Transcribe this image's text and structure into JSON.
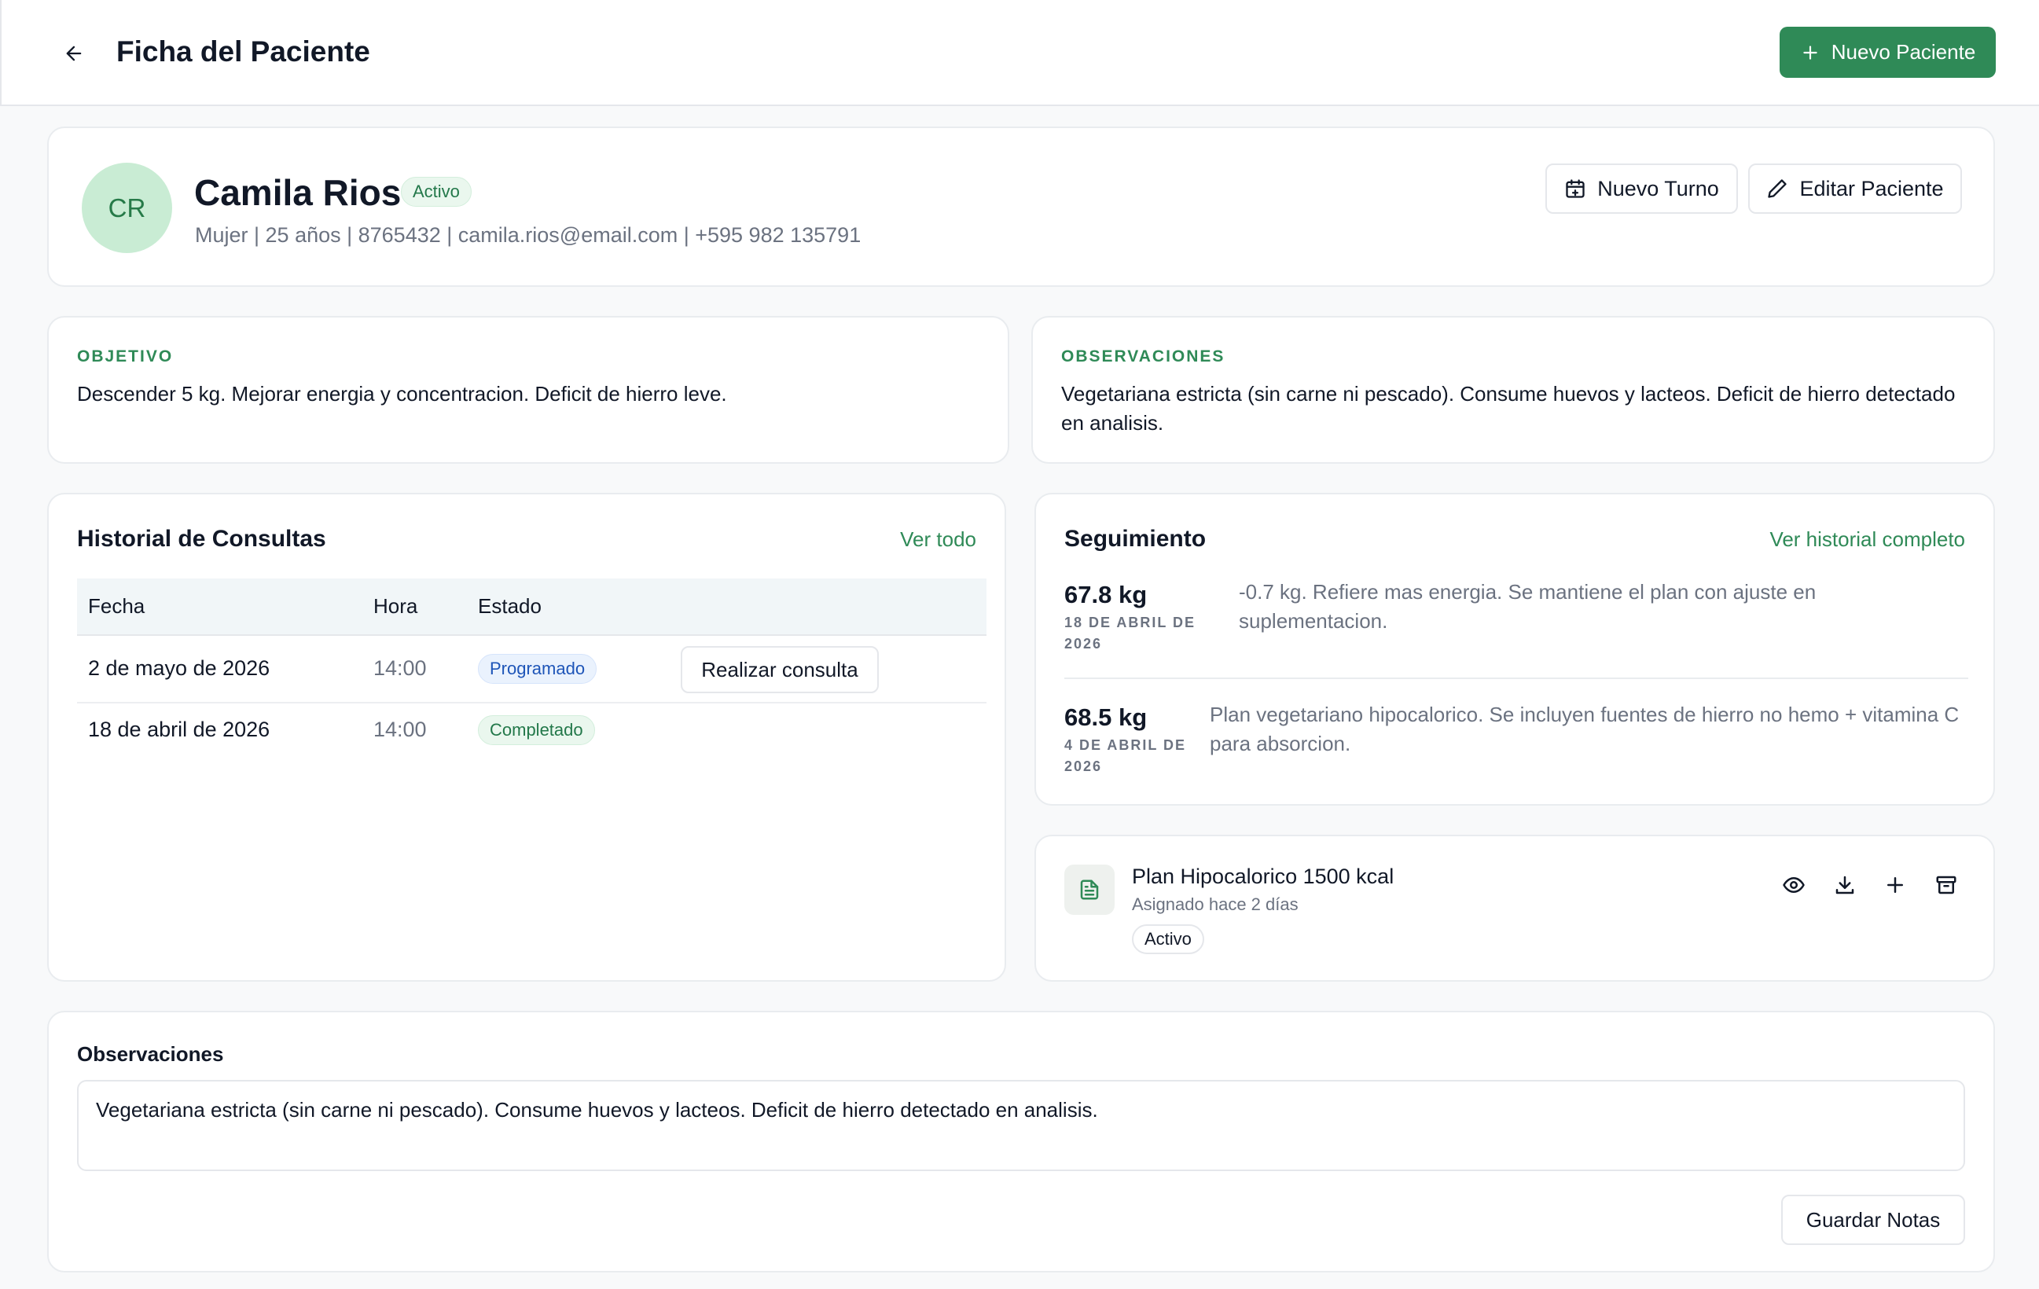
{
  "header": {
    "title": "Ficha del Paciente",
    "new_patient_label": "Nuevo Paciente"
  },
  "patient": {
    "initials": "CR",
    "name": "Camila Rios",
    "status": "Activo",
    "meta": "Mujer | 25 años | 8765432 | camila.rios@email.com | +595 982 135791",
    "new_appointment_label": "Nuevo Turno",
    "edit_label": "Editar Paciente"
  },
  "objective": {
    "label": "OBJETIVO",
    "text": "Descender 5 kg. Mejorar energia y concentracion. Deficit de hierro leve."
  },
  "observations_card": {
    "label": "OBSERVACIONES",
    "text": "Vegetariana estricta (sin carne ni pescado). Consume huevos y lacteos. Deficit de hierro detectado en analisis."
  },
  "history": {
    "title": "Historial de Consultas",
    "link": "Ver todo",
    "columns": [
      "Fecha",
      "Hora",
      "Estado"
    ],
    "rows": [
      {
        "date": "2 de mayo de 2026",
        "time": "14:00",
        "status": "Programado",
        "action": "Realizar consulta"
      },
      {
        "date": "18 de abril de 2026",
        "time": "14:00",
        "status": "Completado"
      }
    ]
  },
  "followup": {
    "title": "Seguimiento",
    "link": "Ver historial completo",
    "entries": [
      {
        "weight": "67.8 kg",
        "date": "18 DE ABRIL DE 2026",
        "note": "-0.7 kg. Refiere mas energia. Se mantiene el plan con ajuste en suplementacion."
      },
      {
        "weight": "68.5 kg",
        "date": "4 DE ABRIL DE 2026",
        "note": "Plan vegetariano hipocalorico. Se incluyen fuentes de hierro no hemo + vitamina C para absorcion."
      }
    ]
  },
  "plan": {
    "title": "Plan Hipocalorico 1500 kcal",
    "subtitle": "Asignado hace 2 días",
    "status": "Activo",
    "icons": [
      "eye-icon",
      "download-icon",
      "plus-icon",
      "archive-icon"
    ]
  },
  "notes": {
    "title": "Observaciones",
    "value": "Vegetariana estricta (sin carne ni pescado). Consume huevos y lacteos. Deficit de hierro detectado en analisis.",
    "save_label": "Guardar Notas"
  },
  "colors": {
    "accent": "#2f8a57",
    "avatar_bg": "#c9ecd4",
    "scheduled": "#1e55b8"
  }
}
